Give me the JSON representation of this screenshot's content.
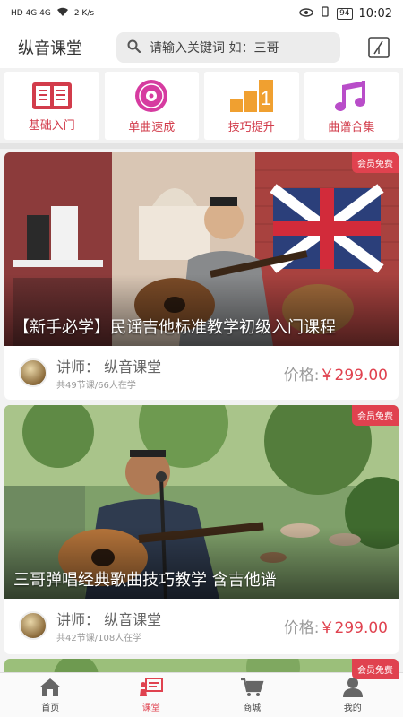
{
  "statusbar": {
    "left": "HD 4G 4G",
    "speed": "2 K/s",
    "battery": "94",
    "time": "10:02"
  },
  "header": {
    "title": "纵音课堂",
    "search_placeholder": "请输入关键词 如：三哥"
  },
  "categories": [
    {
      "label": "基础入门",
      "icon": "book-icon"
    },
    {
      "label": "单曲速成",
      "icon": "disc-icon"
    },
    {
      "label": "技巧提升",
      "icon": "steps-icon"
    },
    {
      "label": "曲谱合集",
      "icon": "music-note-icon"
    }
  ],
  "courses": [
    {
      "badge": "会员免费",
      "title": "【新手必学】民谣吉他标准教学初级入门课程",
      "teacher": "讲师：  纵音课堂",
      "stats": "共49节课/66人在学",
      "price_label": "价格:",
      "price": "￥299.00"
    },
    {
      "badge": "会员免费",
      "title": "三哥弹唱经典歌曲技巧教学 含吉他谱",
      "teacher": "讲师：  纵音课堂",
      "stats": "共42节课/108人在学",
      "price_label": "价格:",
      "price": "￥299.00"
    },
    {
      "badge": "会员免费"
    }
  ],
  "nav": [
    {
      "label": "首页",
      "icon": "home-icon"
    },
    {
      "label": "课堂",
      "icon": "classroom-icon"
    },
    {
      "label": "商城",
      "icon": "cart-icon"
    },
    {
      "label": "我的",
      "icon": "user-icon"
    }
  ],
  "colors": {
    "accent": "#e0424f",
    "category_text": "#d23c4b"
  }
}
